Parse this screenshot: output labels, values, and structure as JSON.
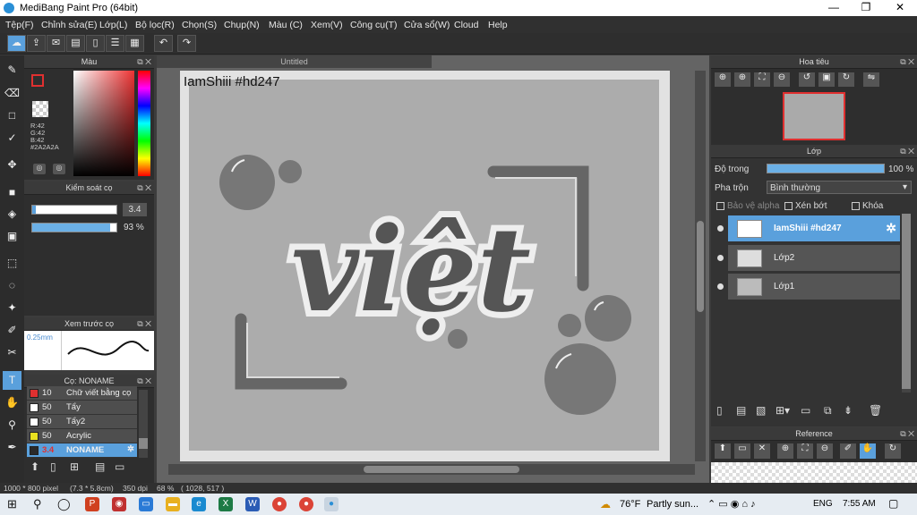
{
  "window": {
    "title": "MediBang Paint Pro (64bit)",
    "min": "—",
    "max": "❐",
    "close": "✕"
  },
  "menu": [
    "Tệp(F)",
    "Chỉnh sửa(E)",
    "Lớp(L)",
    "Bộ lọc(R)",
    "Chọn(S)",
    "Chụp(N)",
    "Màu (C)",
    "Xem(V)",
    "Công cụ(T)",
    "Cửa sổ(W)",
    "Cloud",
    "Help"
  ],
  "color_panel": {
    "title": "Màu",
    "r": "R:42",
    "g": "G:42",
    "b": "B:42",
    "hex": "#2A2A2A",
    "primary": "#2a2a2a"
  },
  "brush_control": {
    "title": "Kiểm soát cọ",
    "size": "3.4",
    "opacity": "93 %",
    "opacity_value": 93
  },
  "brush_preview": {
    "title": "Xem trước cọ",
    "size": "0.25mm"
  },
  "brushes": {
    "title": "Cọ: NONAME",
    "items": [
      {
        "size": "10",
        "name": "Chữ viết bằng cọ",
        "color": "#e03030"
      },
      {
        "size": "50",
        "name": "Tẩy",
        "color": "#ffffff"
      },
      {
        "size": "50",
        "name": "Tẩy2",
        "color": "#ffffff"
      },
      {
        "size": "50",
        "name": "Acrylic",
        "color": "#e8e020"
      },
      {
        "size": "3.4",
        "name": "NONAME",
        "color": "#2a2a2a"
      }
    ]
  },
  "document": {
    "tab": "Untitled",
    "watermark": "IamShiii #hd247",
    "art_text": "việt"
  },
  "navigator": {
    "title": "Hoa tiêu"
  },
  "layers": {
    "title": "Lớp",
    "opacity_label": "Độ trong",
    "opacity": "100 %",
    "blend_label": "Pha trộn",
    "blend": "Bình thường",
    "protect_alpha": "Bảo vệ alpha",
    "clipping": "Xén bớt",
    "lock": "Khóa",
    "items": [
      {
        "name": "IamShiii #hd247",
        "selected": true
      },
      {
        "name": "Lớp2",
        "selected": false
      },
      {
        "name": "Lớp1",
        "selected": false
      }
    ]
  },
  "reference": {
    "title": "Reference"
  },
  "status": {
    "size": "1000 * 800 pixel",
    "cm": "(7.3 * 5.8cm)",
    "dpi": "350 dpi",
    "zoom": "68 %",
    "coords": "( 1028, 517 )"
  },
  "taskbar": {
    "temp": "76°F",
    "weather": "Partly sun...",
    "lang": "ENG",
    "time": "7:55 AM"
  }
}
